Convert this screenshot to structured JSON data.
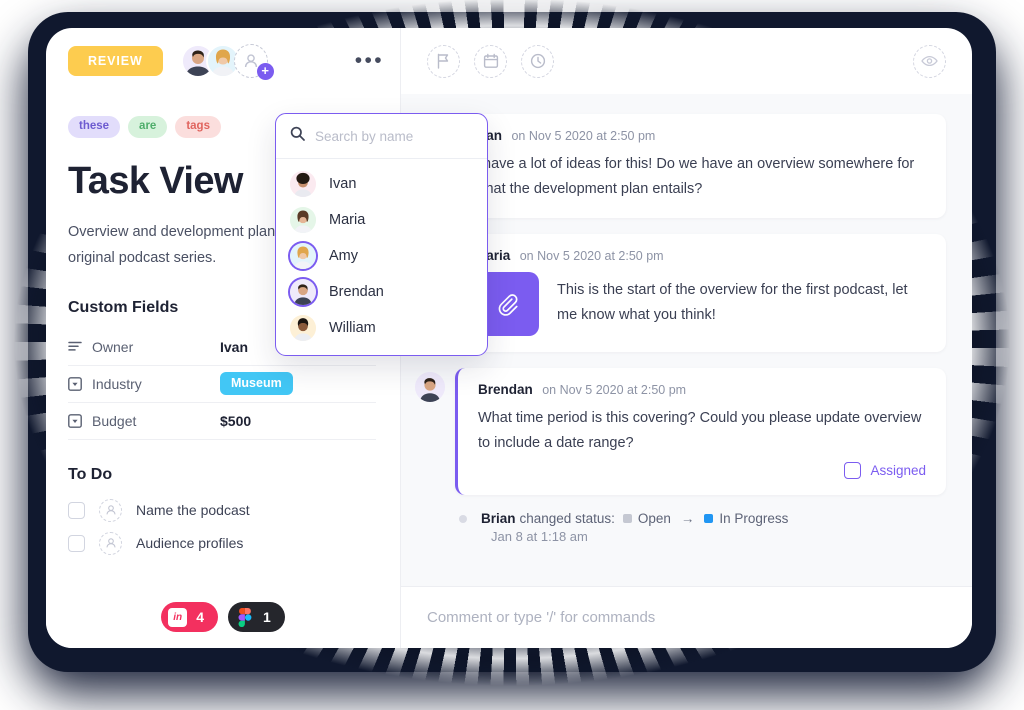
{
  "topbar": {
    "review_label": "REVIEW",
    "more_menu": "•••",
    "icons": [
      "flag-icon",
      "calendar-icon",
      "clock-icon",
      "eye-icon"
    ],
    "add_assignee_plus": "+"
  },
  "assignee_dropdown": {
    "search_placeholder": "Search by name",
    "search_value": "",
    "people": [
      {
        "name": "Ivan",
        "selected": false,
        "skin": "#c88f6e",
        "hair": "#241912",
        "bg": "#fbeaf0"
      },
      {
        "name": "Maria",
        "selected": false,
        "skin": "#e4b596",
        "hair": "#5a3a25",
        "bg": "#e5f6e8"
      },
      {
        "name": "Amy",
        "selected": true,
        "skin": "#f0c9a8",
        "hair": "#e0a64c",
        "bg": "#e3f4fb"
      },
      {
        "name": "Brendan",
        "selected": true,
        "skin": "#d9a684",
        "hair": "#2e2219",
        "bg": "#efeafb"
      },
      {
        "name": "William",
        "selected": false,
        "skin": "#8a5a3b",
        "hair": "#1a1410",
        "bg": "#fdf0d6"
      }
    ]
  },
  "task": {
    "tags": [
      {
        "label": "these",
        "bg": "#e2ddfb",
        "color": "#6d5bd0"
      },
      {
        "label": "are",
        "bg": "#d7f2dc",
        "color": "#4fae6b"
      },
      {
        "label": "tags",
        "bg": "#fbdedd",
        "color": "#e0645e"
      }
    ],
    "title": "Task View",
    "description": "Overview and development plan for our original podcast series."
  },
  "custom_fields": {
    "heading": "Custom Fields",
    "rows": [
      {
        "icon": "list-icon",
        "label": "Owner",
        "value": "Ivan",
        "type": "text"
      },
      {
        "icon": "dropdown-icon",
        "label": "Industry",
        "value": "Museum",
        "type": "pill",
        "pill_bg": "#42c7f5"
      },
      {
        "icon": "dropdown-icon",
        "label": "Budget",
        "value": "$500",
        "type": "text"
      }
    ]
  },
  "todo": {
    "heading": "To Do",
    "items": [
      {
        "label": "Name the podcast",
        "checked": false
      },
      {
        "label": "Audience profiles",
        "checked": false
      }
    ]
  },
  "comments": [
    {
      "author": "Ivan",
      "time": "on Nov 5 2020 at 2:50 pm",
      "text": "I have a lot of ideas for this! Do we have an overview somewhere for what the development plan entails?",
      "avatar": {
        "skin": "#c88f6e",
        "hair": "#241912",
        "bg": "#fbeaf0"
      },
      "has_attachment": false,
      "highlighted": false
    },
    {
      "author": "Maria",
      "time": "on Nov 5 2020 at 2:50 pm",
      "text": "This is the start of the overview for the first podcast, let me know what you think!",
      "avatar": {
        "skin": "#e4b596",
        "hair": "#5a3a25",
        "bg": "#e5f6e8"
      },
      "has_attachment": true,
      "attachment_icon": "paperclip-icon",
      "highlighted": false
    },
    {
      "author": "Brendan",
      "time": "on Nov 5 2020 at 2:50 pm",
      "text": "What time period is this covering? Could you please update overview to include a date range?",
      "avatar": {
        "skin": "#d9a684",
        "hair": "#2e2219",
        "bg": "#efeafb"
      },
      "has_attachment": false,
      "highlighted": true,
      "assigned_label": "Assigned",
      "assigned_checked": false
    }
  ],
  "activity": {
    "actor": "Brian",
    "action": "changed status:",
    "from_status": "Open",
    "from_color": "#c5c8d2",
    "arrow": "→",
    "to_status": "In Progress",
    "to_color": "#2196f3",
    "timestamp": "Jan 8 at 1:18 am"
  },
  "bottom": {
    "badges": [
      {
        "name": "invision",
        "glyph": "in",
        "count": "4",
        "bg": "#f3305f"
      },
      {
        "name": "figma",
        "glyph": "figma",
        "count": "1",
        "bg": "#25262c"
      }
    ],
    "comment_placeholder": "Comment or type '/' for commands",
    "comment_value": ""
  }
}
